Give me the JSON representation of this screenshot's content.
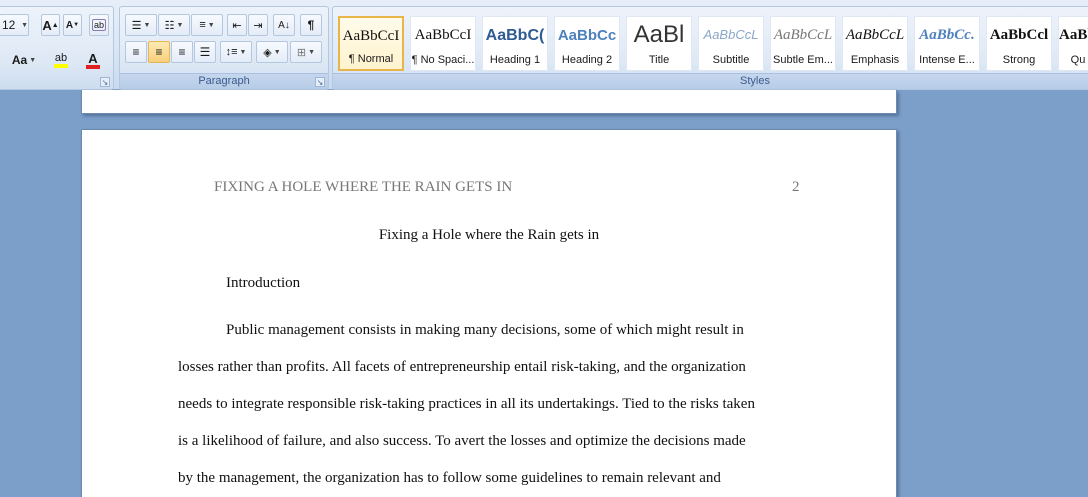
{
  "ribbon": {
    "font": {
      "size_value": "12",
      "grow_label": "A",
      "shrink_label": "A",
      "change_case_label": "Aa",
      "highlight_label": "ab",
      "font_color_label": "A",
      "highlight_color": "#ffff00",
      "font_color": "#e02020"
    },
    "paragraph": {
      "label": "Paragraph",
      "show_marks_label": "¶"
    },
    "styles": {
      "label": "Styles",
      "items": [
        {
          "sample": "AaBbCcI",
          "name": "¶ Normal",
          "color": "#111111"
        },
        {
          "sample": "AaBbCcI",
          "name": "¶ No Spaci...",
          "color": "#111111"
        },
        {
          "sample": "AaBbC(",
          "name": "Heading 1",
          "color": "#2f5b93"
        },
        {
          "sample": "AaBbCc",
          "name": "Heading 2",
          "color": "#4f81bd"
        },
        {
          "sample": "AaBl",
          "name": "Title",
          "color": "#333333"
        },
        {
          "sample": "AaBbCcL",
          "name": "Subtitle",
          "color": "#8aa6c9"
        },
        {
          "sample": "AaBbCcL",
          "name": "Subtle Em...",
          "color": "#777777"
        },
        {
          "sample": "AaBbCcL",
          "name": "Emphasis",
          "color": "#111111"
        },
        {
          "sample": "AaBbCc.",
          "name": "Intense E...",
          "color": "#4f81bd"
        },
        {
          "sample": "AaBbCcl",
          "name": "Strong",
          "color": "#111111"
        },
        {
          "sample": "AaBbC",
          "name": "Qu",
          "color": "#111111"
        }
      ]
    }
  },
  "document": {
    "running_head": "FIXING A HOLE WHERE THE RAIN GETS IN",
    "page_number": "2",
    "title": "Fixing a Hole where the Rain gets in",
    "heading": "Introduction",
    "paragraph_lines": [
      "Public management consists in making many decisions, some of which might result in",
      "losses rather than profits. All facets of entrepreneurship  entail risk-taking, and the organization",
      "needs to integrate responsible risk-taking practices in all its undertakings. Tied to the risks taken",
      "is a likelihood of failure, and also success. To avert the losses and optimize the decisions made",
      "by the management, the organization has to follow some guidelines to remain relevant and"
    ]
  }
}
